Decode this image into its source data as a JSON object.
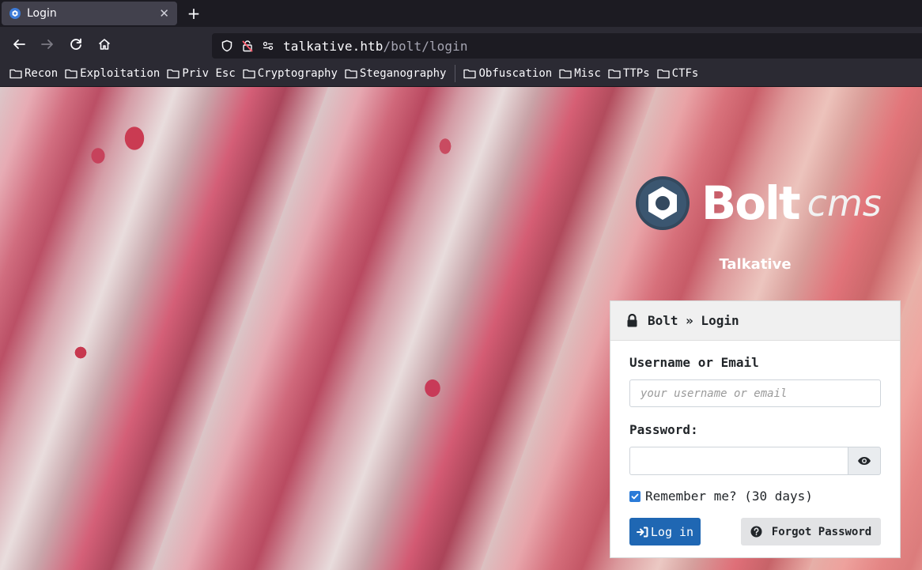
{
  "tab": {
    "title": "Login",
    "close_glyph": "✕",
    "new_tab_glyph": "+"
  },
  "url": {
    "host": "talkative.htb",
    "path": "/bolt/login"
  },
  "bookmarks": [
    "Recon",
    "Exploitation",
    "Priv Esc",
    "Cryptography",
    "Steganography",
    "Obfuscation",
    "Misc",
    "TTPs",
    "CTFs"
  ],
  "logo": {
    "bold": "Bolt",
    "light": "cms"
  },
  "site_name": "Talkative",
  "login": {
    "header": "Bolt » Login",
    "username_label": "Username or Email",
    "username_placeholder": "your username or email",
    "password_label": "Password:",
    "remember_label": "Remember me? (30 days)",
    "remember_checked": true,
    "login_button": "Log in",
    "forgot_button": "Forgot Password"
  },
  "colors": {
    "accent": "#1f67b3",
    "checkbox": "#2b7bd8",
    "browser_bg": "#1c1b22"
  }
}
